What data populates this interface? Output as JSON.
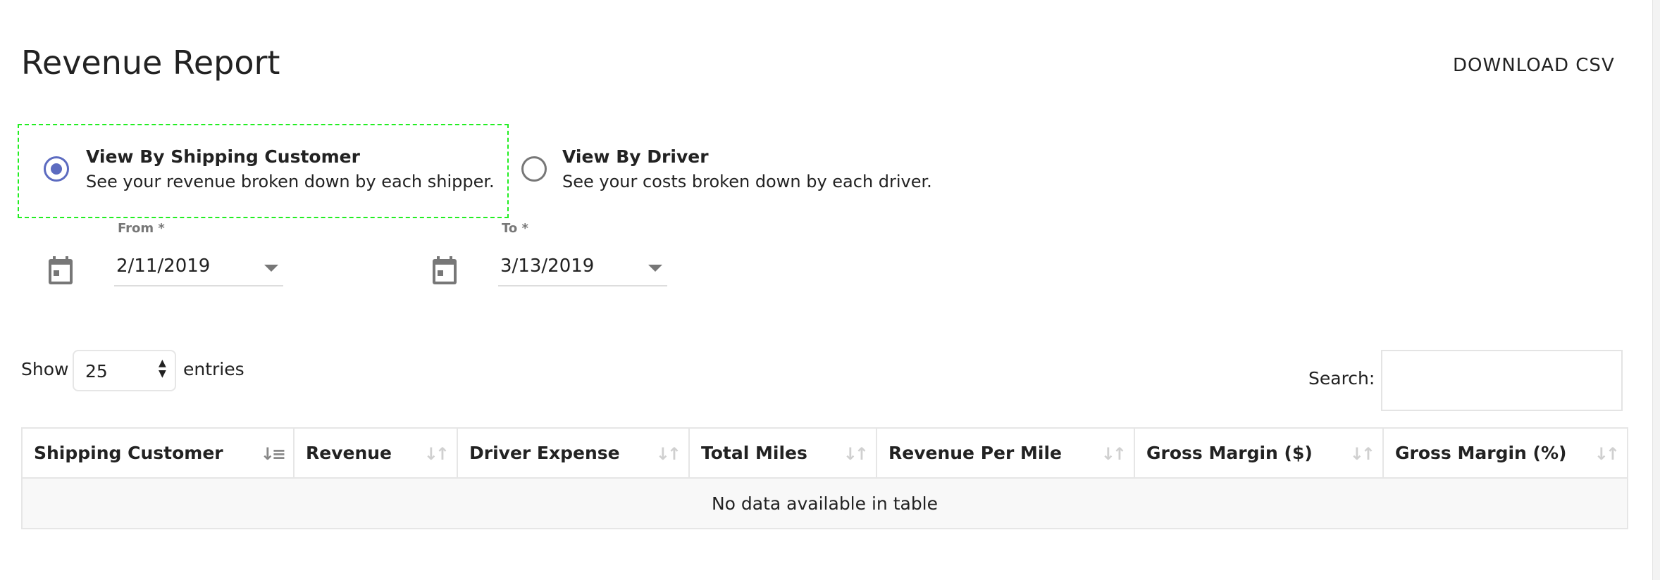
{
  "header": {
    "title": "Revenue Report",
    "download_label": "DOWNLOAD CSV"
  },
  "view_options": [
    {
      "title": "View By Shipping Customer",
      "description": "See your revenue broken down by each shipper.",
      "selected": true
    },
    {
      "title": "View By Driver",
      "description": "See your costs broken down by each driver.",
      "selected": false
    }
  ],
  "date_range": {
    "from": {
      "label": "From *",
      "value": "2/11/2019",
      "icon": "calendar-icon"
    },
    "to": {
      "label": "To *",
      "value": "3/13/2019",
      "icon": "calendar-icon"
    }
  },
  "length_menu": {
    "prefix": "Show",
    "value": "25",
    "suffix": "entries"
  },
  "search": {
    "label": "Search:",
    "value": ""
  },
  "table": {
    "columns": [
      "Shipping Customer",
      "Revenue",
      "Driver Expense",
      "Total Miles",
      "Revenue Per Mile",
      "Gross Margin ($)",
      "Gross Margin (%)"
    ],
    "sorted_column": "Shipping Customer",
    "empty_message": "No data available in table"
  },
  "colors": {
    "accent": "#5c6bc0",
    "focus_outline": "#22ee22"
  }
}
